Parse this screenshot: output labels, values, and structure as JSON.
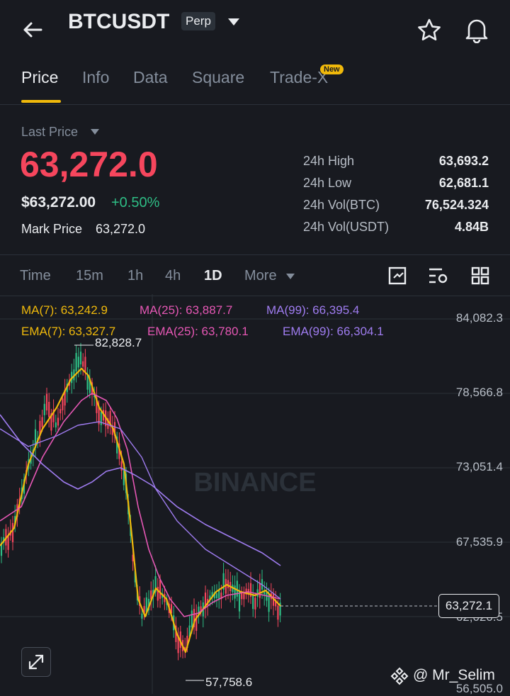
{
  "header": {
    "title": "BTCUSDT",
    "badge": "Perp"
  },
  "tabs": [
    {
      "label": "Price"
    },
    {
      "label": "Info"
    },
    {
      "label": "Data"
    },
    {
      "label": "Square"
    },
    {
      "label": "Trade-X"
    }
  ],
  "new_badge": "New",
  "price": {
    "last_price_label": "Last Price",
    "last_price": "63,272.0",
    "usd_value": "$63,272.00",
    "change": "+0.50%",
    "mark_label": "Mark Price",
    "mark_value": "63,272.0"
  },
  "stats": [
    {
      "label": "24h High",
      "value": "63,693.2"
    },
    {
      "label": "24h Low",
      "value": "62,681.1"
    },
    {
      "label": "24h Vol(BTC)",
      "value": "76,524.324"
    },
    {
      "label": "24h Vol(USDT)",
      "value": "4.84B"
    }
  ],
  "timeframes": [
    {
      "label": "Time"
    },
    {
      "label": "15m"
    },
    {
      "label": "1h"
    },
    {
      "label": "4h"
    },
    {
      "label": "1D"
    },
    {
      "label": "More"
    }
  ],
  "indicators": {
    "ma7": "MA(7): 63,242.9",
    "ma25": "MA(25): 63,887.7",
    "ma99": "MA(99): 66,395.4",
    "ema7": "EMA(7): 63,327.7",
    "ema25": "EMA(25): 63,780.1",
    "ema99": "EMA(99): 66,304.1"
  },
  "axis_labels": [
    "84,082.3",
    "78,566.8",
    "73,051.4",
    "67,535.9",
    "62,020.5",
    "56,505.0"
  ],
  "high_marker": "82,828.7",
  "low_marker": "57,758.6",
  "current_price_tag": "63,272.1",
  "watermark": "BINANCE",
  "credit": "@ Mr_Selim",
  "colors": {
    "background": "#181a20",
    "up": "#2ebd85",
    "down": "#f6465d",
    "accent": "#f0b90b",
    "ma7": "#f0b90b",
    "ma25": "#e557b4",
    "ma99": "#9f7cf0"
  },
  "icons": [
    "back-arrow-icon",
    "dropdown-caret-icon",
    "star-icon",
    "bell-icon",
    "chart-style-icon",
    "indicator-settings-icon",
    "grid-layout-icon",
    "expand-icon"
  ]
}
